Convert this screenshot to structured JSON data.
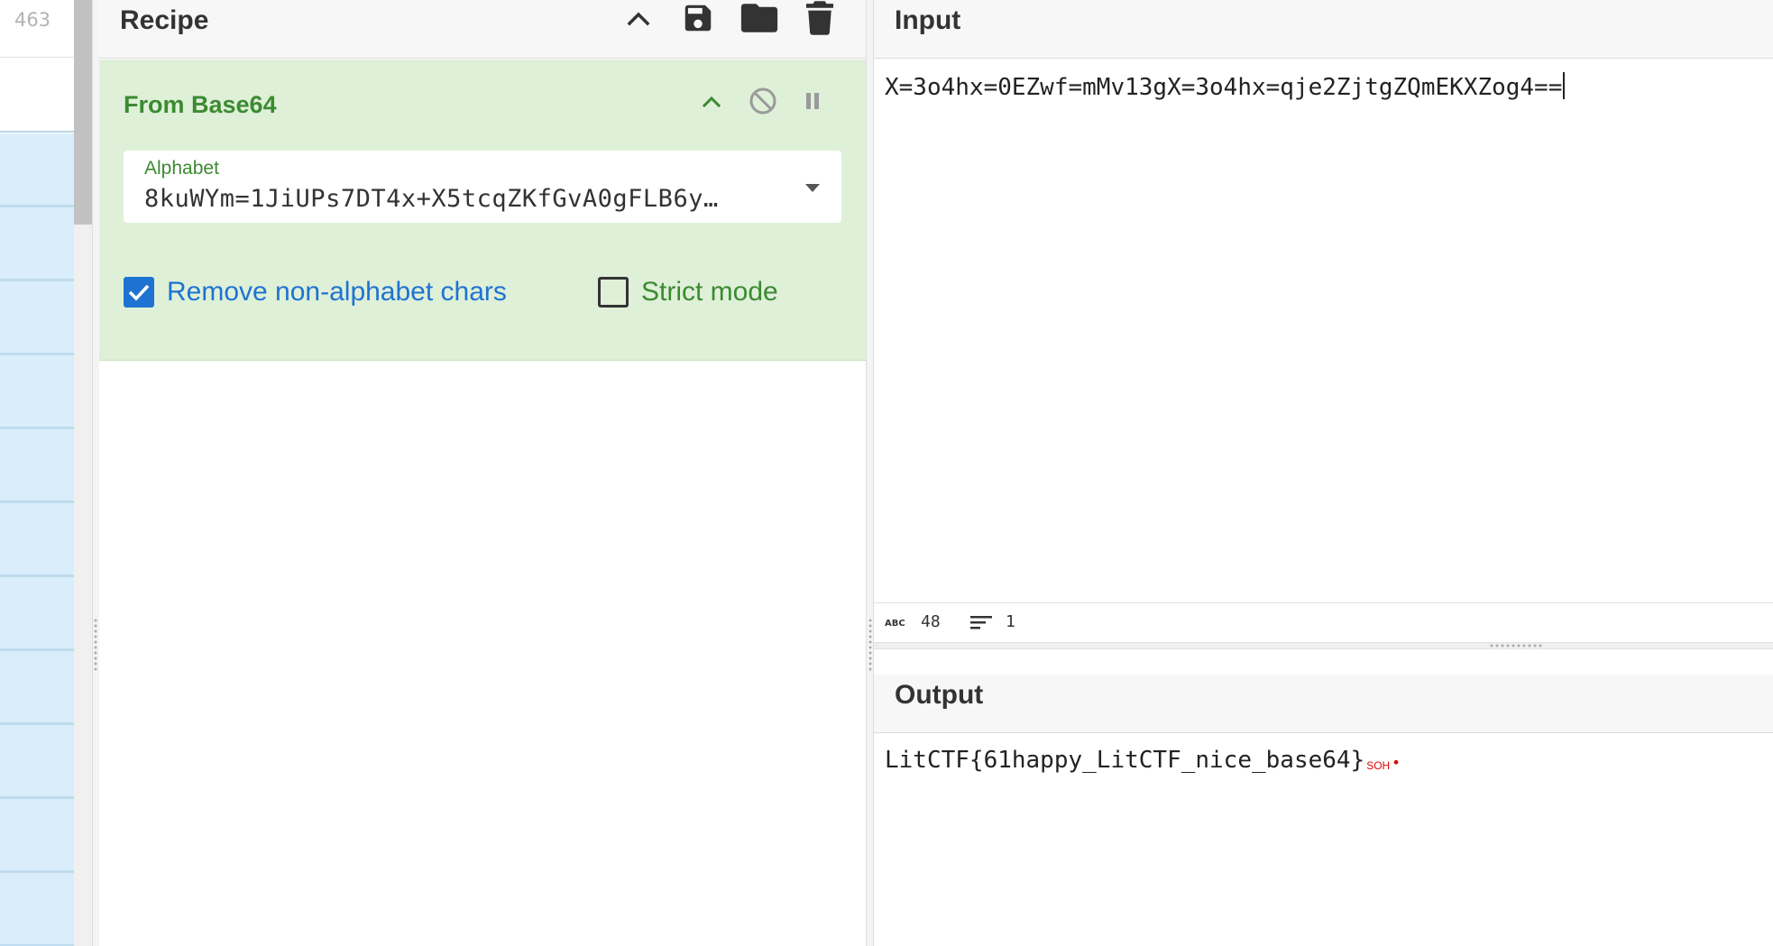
{
  "operations": {
    "count": "463"
  },
  "recipe": {
    "title": "Recipe",
    "operation": {
      "name": "From Base64",
      "alphabet_label": "Alphabet",
      "alphabet_value": "8kuWYm=1JiUPs7DT4x+X5tcqZKfGvA0gFLB6y…",
      "remove_non_alphabet": {
        "label": "Remove non-alphabet chars",
        "checked": true
      },
      "strict_mode": {
        "label": "Strict mode",
        "checked": false
      }
    }
  },
  "input": {
    "title": "Input",
    "text": "X=3o4hx=0EZwf=mMv13gX=3o4hx=qje2ZjtgZQmEKXZog4==",
    "stats": {
      "length": "48",
      "lines": "1"
    }
  },
  "output": {
    "title": "Output",
    "text": "LitCTF{61happy_LitCTF_nice_base64}",
    "control_char": "SOH",
    "control_dot": "•"
  },
  "colors": {
    "green": "#3c8a32",
    "card": "#dff0d8",
    "check_blue": "#1e73d2",
    "ops_blue": "#d9eefa",
    "red": "#e00000"
  },
  "icons": [
    "chevron-up-icon",
    "save-icon",
    "folder-icon",
    "trash-icon",
    "disable-icon",
    "pause-icon",
    "dropdown-arrow-icon",
    "checkmark-icon",
    "abc-icon",
    "lines-icon"
  ]
}
